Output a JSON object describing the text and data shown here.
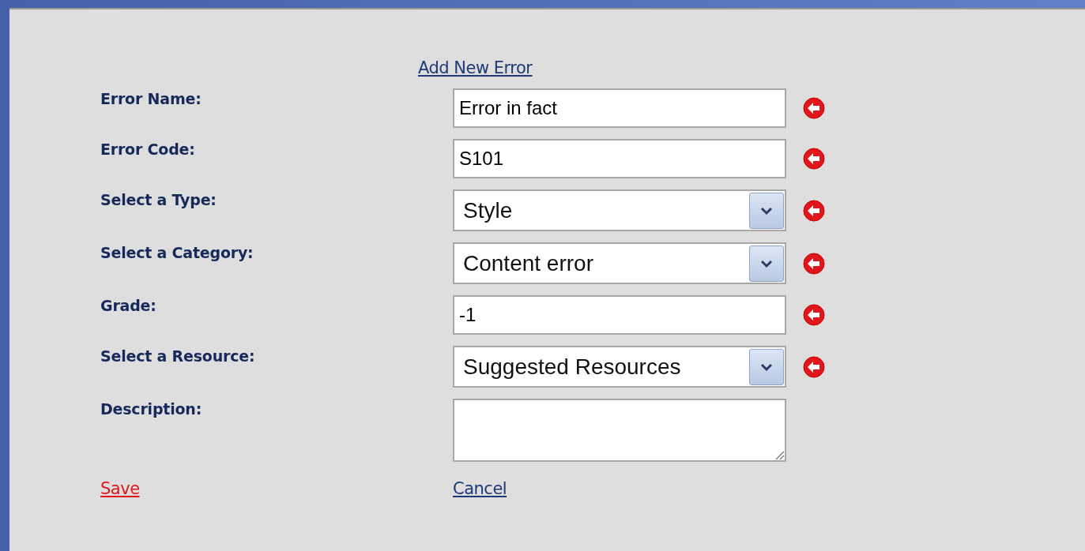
{
  "header_link": "Add New Error",
  "fields": [
    {
      "label": "Error Name:",
      "kind": "text",
      "value": "Error in fact",
      "error_marker": true
    },
    {
      "label": "Error Code:",
      "kind": "text",
      "value": "S101",
      "error_marker": true
    },
    {
      "label": "Select a Type:",
      "kind": "select",
      "value": "Style",
      "error_marker": true
    },
    {
      "label": "Select a Category:",
      "kind": "select",
      "value": "Content error",
      "error_marker": true
    },
    {
      "label": "Grade:",
      "kind": "text",
      "value": "-1",
      "error_marker": true
    },
    {
      "label": "Select a Resource:",
      "kind": "select",
      "value": "Suggested Resources",
      "error_marker": true
    },
    {
      "label": "Description:",
      "kind": "textarea",
      "error_marker": false
    }
  ],
  "actions": [
    {
      "label": "Save",
      "kind": "save"
    },
    {
      "label": "Cancel",
      "kind": "cancel"
    }
  ]
}
